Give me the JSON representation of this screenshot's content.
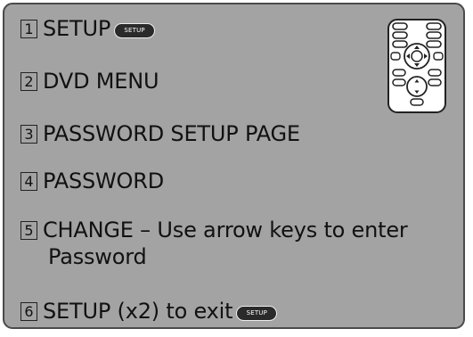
{
  "steps": [
    {
      "num": "1",
      "text": "SETUP",
      "button": "SETUP"
    },
    {
      "num": "2",
      "text": "DVD MENU"
    },
    {
      "num": "3",
      "text": "PASSWORD SETUP PAGE"
    },
    {
      "num": "4",
      "text": "PASSWORD"
    },
    {
      "num": "5",
      "text": "CHANGE – Use arrow keys to enter",
      "text_line2": "Password"
    },
    {
      "num": "6",
      "text": "SETUP (x2) to exit",
      "button": "SETUP"
    }
  ],
  "remote": {
    "icon": "remote-control-icon"
  },
  "colors": {
    "panel": "#a3a3a3",
    "border": "#4a4a4a",
    "button": "#2a2a2a"
  }
}
